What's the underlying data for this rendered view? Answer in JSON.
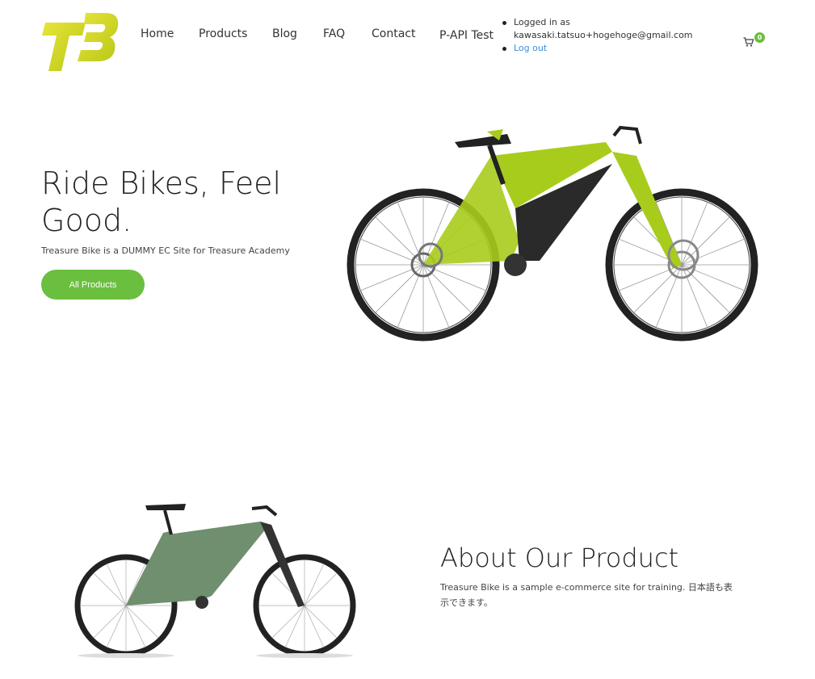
{
  "nav": {
    "home": "Home",
    "products": "Products",
    "blog": "Blog",
    "faq": "FAQ",
    "contact": "Contact",
    "papi": "P-API Test"
  },
  "account": {
    "logged_in_label": "Logged in as",
    "email": "kawasaki.tatsuo+hogehoge@gmail.com",
    "logout": "Log out"
  },
  "cart": {
    "count": "0",
    "icon": "cart-icon"
  },
  "hero": {
    "title": "Ride Bikes, Feel Good.",
    "subtitle": "Treasure Bike is a DUMMY EC Site for Treasure Academy",
    "button": "All Products"
  },
  "about": {
    "title": "About Our Product",
    "text": "Treasure Bike is a sample e-commerce site for training. 日本語も表示できます。"
  },
  "colors": {
    "accent_green": "#6bbf3f",
    "logo_yellow": "#d4d61c",
    "link_blue": "#3c8ed8",
    "bike1_frame": "#a8cc1c",
    "bike2_frame": "#6f8f6f"
  }
}
